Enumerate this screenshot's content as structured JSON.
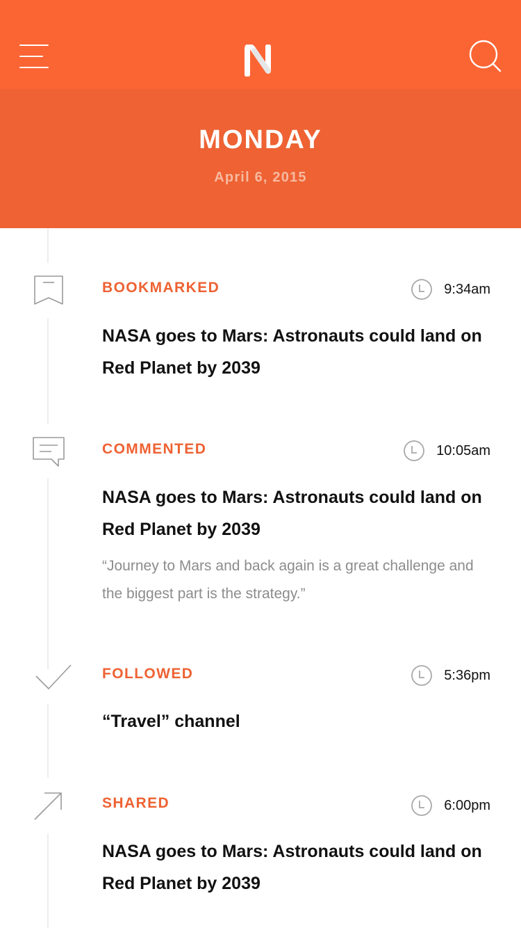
{
  "header": {
    "menu_icon": "hamburger-menu-icon",
    "logo_icon": "n-logo-icon",
    "search_icon": "search-icon",
    "brand_color": "#fb6534"
  },
  "day": {
    "title": "MONDAY",
    "date": "April 6, 2015"
  },
  "entries": [
    {
      "type": "BOOKMARKED",
      "icon": "bookmark-icon",
      "time": "9:34am",
      "title": "NASA goes to Mars: Astronauts could land on Red Planet by 2039",
      "quote": ""
    },
    {
      "type": "COMMENTED",
      "icon": "comment-icon",
      "time": "10:05am",
      "title": "NASA goes to Mars: Astronauts could land on Red Planet by 2039",
      "quote": "“Journey to Mars and back again is a great challenge and the biggest part is the strategy.”"
    },
    {
      "type": "FOLLOWED",
      "icon": "checkmark-icon",
      "time": "5:36pm",
      "title": "“Travel” channel",
      "quote": ""
    },
    {
      "type": "SHARED",
      "icon": "share-arrow-icon",
      "time": "6:00pm",
      "title": "NASA goes to Mars: Astronauts could land on Red Planet by 2039",
      "quote": ""
    }
  ],
  "colors": {
    "accent": "#ee6233",
    "text": "#111111",
    "muted": "#8c8c8c"
  }
}
